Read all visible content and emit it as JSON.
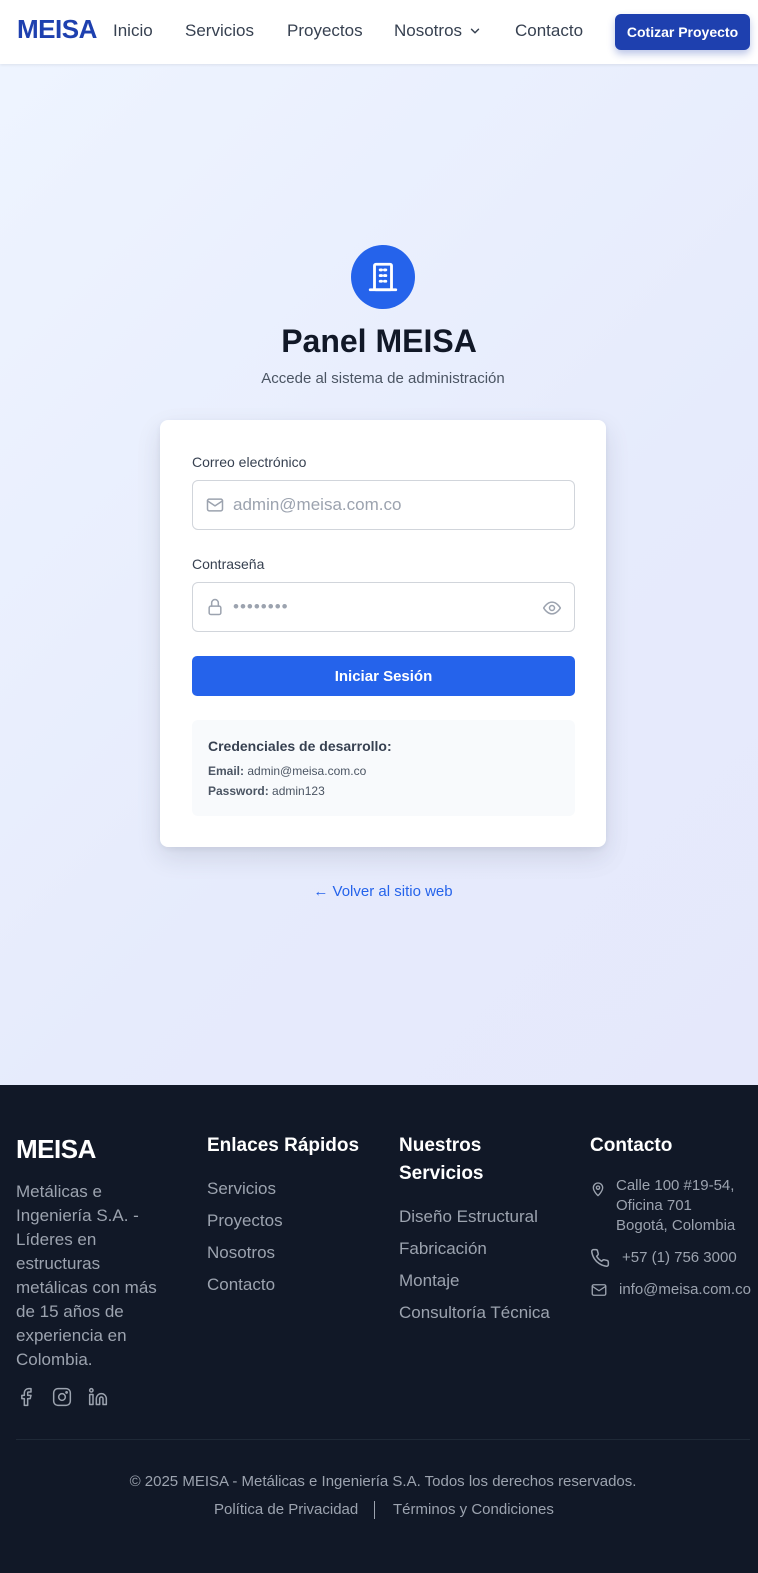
{
  "nav": {
    "logo": "MEISA",
    "links": [
      "Inicio",
      "Servicios",
      "Proyectos",
      "Nosotros",
      "Contacto"
    ],
    "cta": "Cotizar Proyecto"
  },
  "login": {
    "title": "Panel MEISA",
    "subtitle": "Accede al sistema de administración",
    "email_label": "Correo electrónico",
    "email_placeholder": "admin@meisa.com.co",
    "password_label": "Contraseña",
    "password_value": "••••••••",
    "submit": "Iniciar Sesión",
    "dev": {
      "title": "Credenciales de desarrollo:",
      "email_key": "Email:",
      "email_value": "admin@meisa.com.co",
      "password_key": "Password:",
      "password_value": "admin123"
    },
    "back": "← Volver al sitio web"
  },
  "footer": {
    "logo": "MEISA",
    "description": "Metálicas e Ingeniería S.A. - Líderes en estructuras metálicas con más de 15 años de experiencia en Colombia.",
    "quick_links_title": "Enlaces Rápidos",
    "quick_links": [
      "Servicios",
      "Proyectos",
      "Nosotros",
      "Contacto"
    ],
    "services_title": "Nuestros Servicios",
    "services": [
      "Diseño Estructural",
      "Fabricación",
      "Montaje",
      "Consultoría Técnica"
    ],
    "contact_title": "Contacto",
    "address_line1": "Calle 100 #19-54,",
    "address_line2": "Oficina 701",
    "address_line3": "Bogotá, Colombia",
    "phone": "+57 (1) 756 3000",
    "email": "info@meisa.com.co",
    "copyright": "© 2025 MEISA - Metálicas e Ingeniería S.A. Todos los derechos reservados.",
    "privacy": "Política de Privacidad",
    "terms": "Términos y Condiciones"
  },
  "icons": [
    "building-icon",
    "mail-icon",
    "lock-icon",
    "eye-icon",
    "chevron-down-icon",
    "facebook-icon",
    "instagram-icon",
    "linkedin-icon",
    "map-pin-icon",
    "phone-icon"
  ],
  "colors": {
    "brand": "#1e40af",
    "primary": "#2563eb",
    "footer_bg": "#111827"
  }
}
